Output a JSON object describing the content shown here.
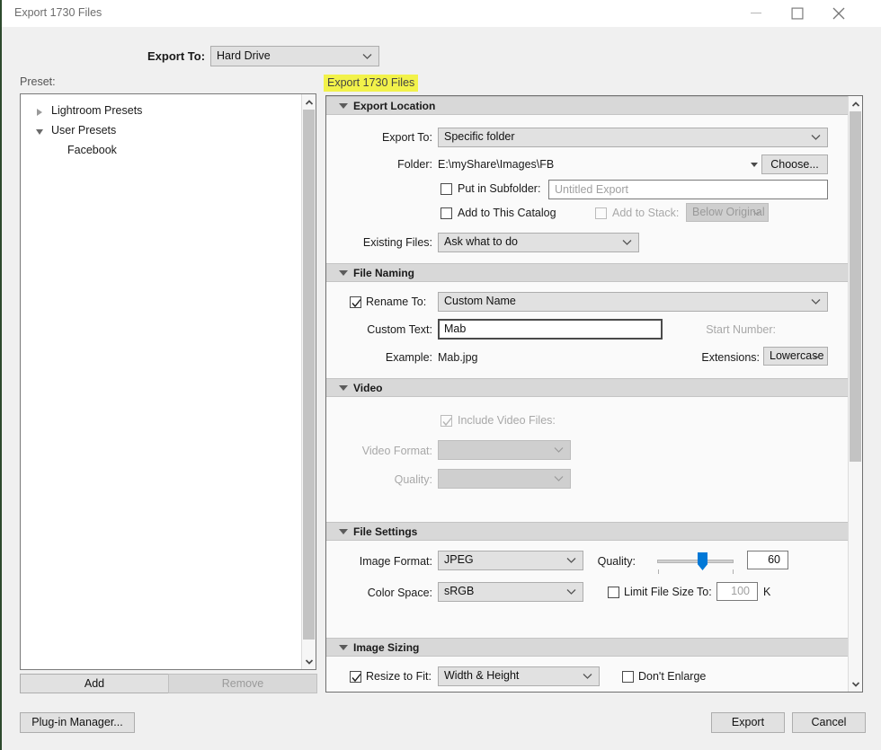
{
  "window": {
    "title": "Export 1730 Files",
    "minimize_icon": "minimize-icon",
    "maximize_icon": "maximize-icon",
    "close_icon": "close-icon"
  },
  "top": {
    "export_to_label": "Export To:",
    "export_to_value": "Hard Drive",
    "preset_label": "Preset:",
    "export_tab_label": "Export 1730 Files",
    "highlight_color": "#f2f24a"
  },
  "preset_tree": [
    {
      "label": "Lightroom Presets",
      "expanded": false,
      "indent": 0
    },
    {
      "label": "User Presets",
      "expanded": true,
      "indent": 0
    },
    {
      "label": "Facebook",
      "expanded": null,
      "indent": 1
    }
  ],
  "preset_buttons": {
    "add": "Add",
    "remove": "Remove",
    "remove_disabled": true
  },
  "footer": {
    "plugin_manager": "Plug-in Manager...",
    "export": "Export",
    "cancel": "Cancel"
  },
  "sections": {
    "export_location": {
      "title": "Export Location",
      "export_to_label": "Export To:",
      "export_to_value": "Specific folder",
      "folder_label": "Folder:",
      "folder_value": "E:\\myShare\\Images\\FB",
      "choose_button": "Choose...",
      "put_in_subfolder_label": "Put in Subfolder:",
      "put_in_subfolder_checked": false,
      "subfolder_placeholder": "Untitled Export",
      "add_to_catalog_label": "Add to This Catalog",
      "add_to_catalog_checked": false,
      "add_to_stack_label": "Add to Stack:",
      "add_to_stack_checked": false,
      "add_to_stack_disabled": true,
      "stack_position_value": "Below Original",
      "existing_files_label": "Existing Files:",
      "existing_files_value": "Ask what to do"
    },
    "file_naming": {
      "title": "File Naming",
      "rename_to_label": "Rename To:",
      "rename_to_checked": true,
      "rename_to_value": "Custom Name",
      "custom_text_label": "Custom Text:",
      "custom_text_value": "Mab",
      "start_number_label": "Start Number:",
      "start_number_disabled": true,
      "example_label": "Example:",
      "example_value": "Mab.jpg",
      "extensions_label": "Extensions:",
      "extensions_value": "Lowercase"
    },
    "video": {
      "title": "Video",
      "include_video_label": "Include Video Files:",
      "include_video_checked": true,
      "include_video_disabled": true,
      "video_format_label": "Video Format:",
      "video_format_value": "",
      "quality_label": "Quality:",
      "quality_value": ""
    },
    "file_settings": {
      "title": "File Settings",
      "image_format_label": "Image Format:",
      "image_format_value": "JPEG",
      "color_space_label": "Color Space:",
      "color_space_value": "sRGB",
      "quality_label": "Quality:",
      "quality_value": "60",
      "quality_percent": 60,
      "slider_accent": "#0078d7",
      "limit_file_size_label": "Limit File Size To:",
      "limit_file_size_checked": false,
      "limit_file_size_value": "100",
      "limit_file_size_unit": "K"
    },
    "image_sizing": {
      "title": "Image Sizing",
      "resize_to_fit_label": "Resize to Fit:",
      "resize_to_fit_checked": true,
      "resize_to_fit_value": "Width & Height",
      "dont_enlarge_label": "Don't Enlarge",
      "dont_enlarge_checked": false
    }
  }
}
